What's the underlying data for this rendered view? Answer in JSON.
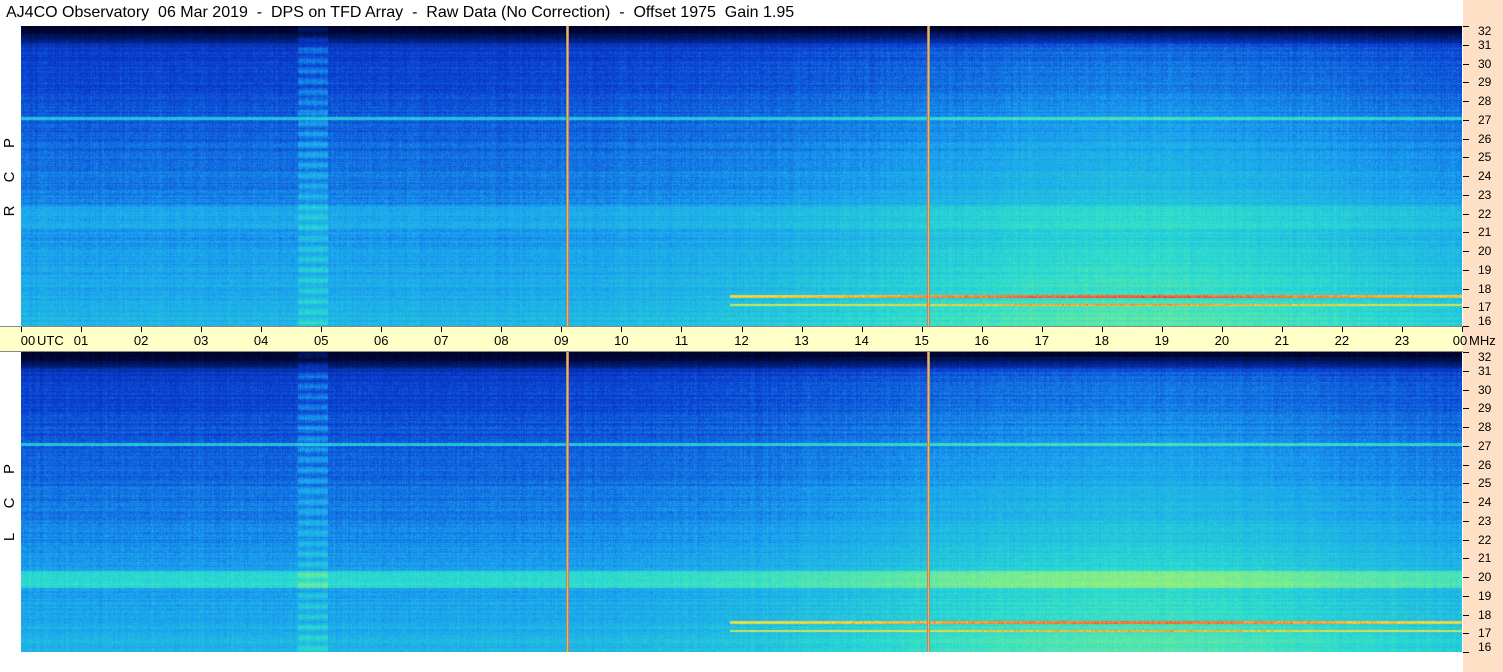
{
  "title": "AJ4CO Observatory  06 Mar 2019  -  DPS on TFD Array  -  Raw Data (No Correction)  -  Offset 1975  Gain 1.95",
  "chart_data": {
    "type": "heatmap",
    "panels": [
      {
        "name": "R C P",
        "polarization_letters": [
          "R",
          "C",
          "P"
        ]
      },
      {
        "name": "L C P",
        "polarization_letters": [
          "L",
          "C",
          "P"
        ]
      }
    ],
    "x_axis": {
      "unit": "UTC",
      "range_hours": [
        0,
        24
      ],
      "tick_labels": [
        "00",
        "01",
        "02",
        "03",
        "04",
        "05",
        "06",
        "07",
        "08",
        "09",
        "10",
        "11",
        "12",
        "13",
        "14",
        "15",
        "16",
        "17",
        "18",
        "19",
        "20",
        "21",
        "22",
        "23",
        "00"
      ]
    },
    "y_axis": {
      "unit": "MHz",
      "range_mhz": [
        16,
        32
      ],
      "tick_labels": [
        "16",
        "17",
        "18",
        "19",
        "20",
        "21",
        "22",
        "23",
        "24",
        "25",
        "26",
        "27",
        "28",
        "29",
        "30",
        "31",
        "32"
      ]
    },
    "markers_utc_hours": [
      9.1,
      15.1
    ],
    "colormap": [
      "#000020",
      "#001a6e",
      "#0a3cd0",
      "#1aa0f0",
      "#2adcd0",
      "#8ef080",
      "#f0e040",
      "#ff3030"
    ]
  }
}
